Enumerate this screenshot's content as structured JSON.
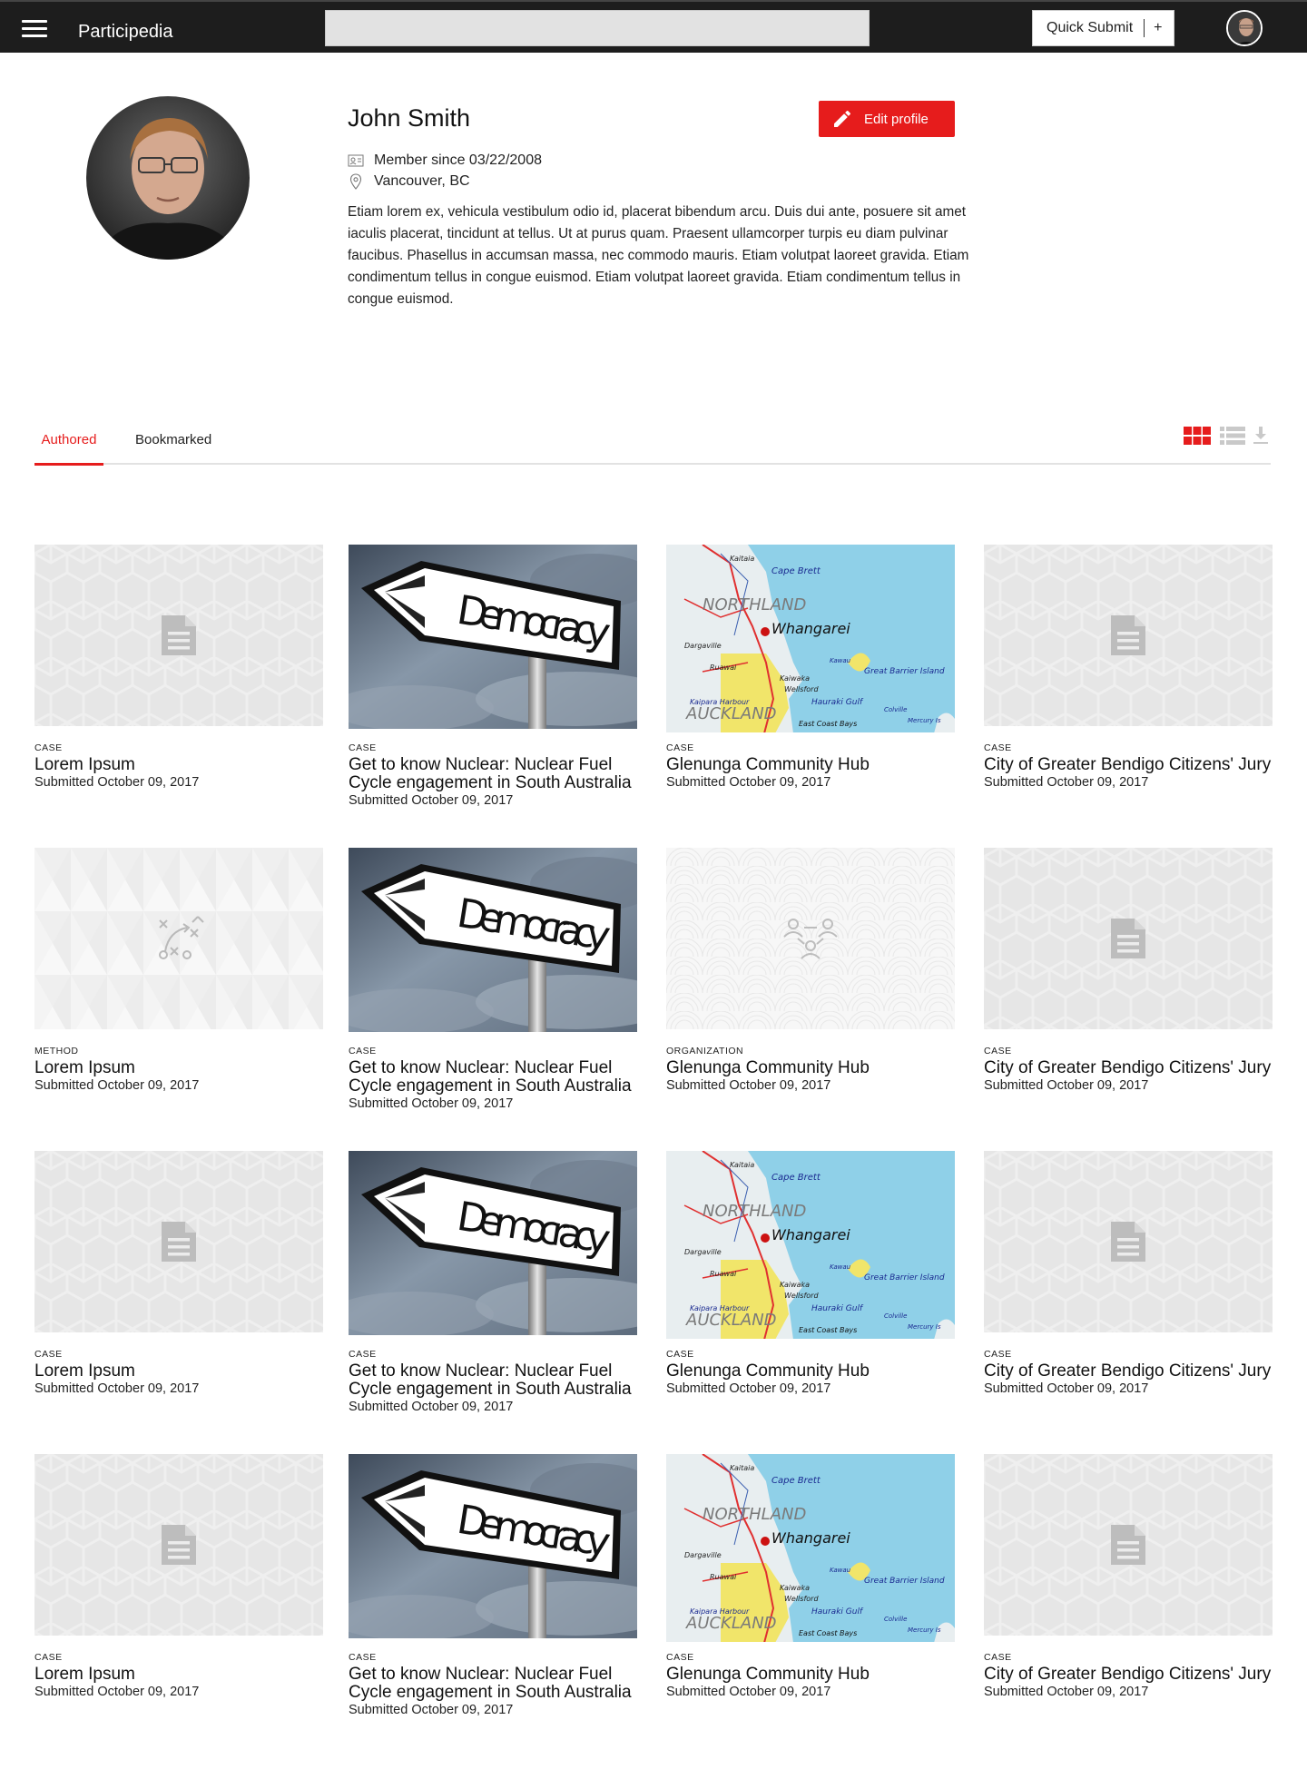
{
  "header": {
    "brand": "Participedia",
    "search_value": "",
    "quick_submit_label": "Quick Submit",
    "quick_submit_plus": "+"
  },
  "profile": {
    "name": "John Smith",
    "edit_label": "Edit profile",
    "member_since": "Member since 03/22/2008",
    "location": "Vancouver, BC",
    "bio": "Etiam lorem ex, vehicula vestibulum odio id, placerat bibendum arcu. Duis dui ante, posuere sit amet iaculis placerat, tincidunt at tellus. Ut at purus quam. Praesent ullamcorper turpis eu diam pulvinar faucibus. Phasellus in accumsan massa, nec commodo mauris. Etiam volutpat laoreet gravida. Etiam condimentum tellus in congue euismod. Etiam volutpat laoreet gravida. Etiam condimentum tellus in congue euismod."
  },
  "tabs": [
    {
      "label": "Authored",
      "active": true
    },
    {
      "label": "Bookmarked",
      "active": false
    }
  ],
  "view_options": {
    "active": "grid"
  },
  "colors": {
    "accent": "#e61c1c",
    "header_bg": "#1d1d1d",
    "placeholder_bg": "#e6e6e6"
  },
  "cards": [
    {
      "type": "CASE",
      "title": "Lorem Ipsum",
      "date": "Submitted October 09, 2017",
      "thumb": "doc-placeholder"
    },
    {
      "type": "CASE",
      "title": "Get to know Nuclear: Nuclear Fuel Cycle engagement in South Australia",
      "date": "Submitted October 09, 2017",
      "thumb": "democracy-photo"
    },
    {
      "type": "CASE",
      "title": "Glenunga Community Hub",
      "date": "Submitted October 09, 2017",
      "thumb": "northland-map"
    },
    {
      "type": "CASE",
      "title": "City of Greater Bendigo Citizens' Jury",
      "date": "Submitted October 09, 2017",
      "thumb": "doc-placeholder"
    },
    {
      "type": "METHOD",
      "title": "Lorem Ipsum",
      "date": "Submitted October 09, 2017",
      "thumb": "method-placeholder"
    },
    {
      "type": "CASE",
      "title": "Get to know Nuclear: Nuclear Fuel Cycle engagement in South Australia",
      "date": "Submitted October 09, 2017",
      "thumb": "democracy-photo"
    },
    {
      "type": "ORGANIZATION",
      "title": "Glenunga Community Hub",
      "date": "Submitted October 09, 2017",
      "thumb": "organization-placeholder"
    },
    {
      "type": "CASE",
      "title": "City of Greater Bendigo Citizens' Jury",
      "date": "Submitted October 09, 2017",
      "thumb": "doc-placeholder"
    },
    {
      "type": "CASE",
      "title": "Lorem Ipsum",
      "date": "Submitted October 09, 2017",
      "thumb": "doc-placeholder"
    },
    {
      "type": "CASE",
      "title": "Get to know Nuclear: Nuclear Fuel Cycle engagement in South Australia",
      "date": "Submitted October 09, 2017",
      "thumb": "democracy-photo"
    },
    {
      "type": "CASE",
      "title": "Glenunga Community Hub",
      "date": "Submitted October 09, 2017",
      "thumb": "northland-map"
    },
    {
      "type": "CASE",
      "title": "City of Greater Bendigo Citizens' Jury",
      "date": "Submitted October 09, 2017",
      "thumb": "doc-placeholder"
    },
    {
      "type": "CASE",
      "title": "Lorem Ipsum",
      "date": "Submitted October 09, 2017",
      "thumb": "doc-placeholder"
    },
    {
      "type": "CASE",
      "title": "Get to know Nuclear: Nuclear Fuel Cycle engagement in South Australia",
      "date": "Submitted October 09, 2017",
      "thumb": "democracy-photo"
    },
    {
      "type": "CASE",
      "title": "Glenunga Community Hub",
      "date": "Submitted October 09, 2017",
      "thumb": "northland-map"
    },
    {
      "type": "CASE",
      "title": "City of Greater Bendigo Citizens' Jury",
      "date": "Submitted October 09, 2017",
      "thumb": "doc-placeholder"
    }
  ],
  "thumb_text": {
    "democracy_sign": "Democracy",
    "map_labels": [
      "Cape Brett",
      "NORTHLAND",
      "Whangarei",
      "AUCKLAND",
      "Great Barrier Island",
      "Hauraki Gulf",
      "Kaipara Harbour",
      "East Coast Bays",
      "Mercury Is",
      "Dargaville",
      "Ruawai",
      "Kaiwaka",
      "Wellsford",
      "Kawau",
      "Colville",
      "Kaitaia"
    ]
  }
}
